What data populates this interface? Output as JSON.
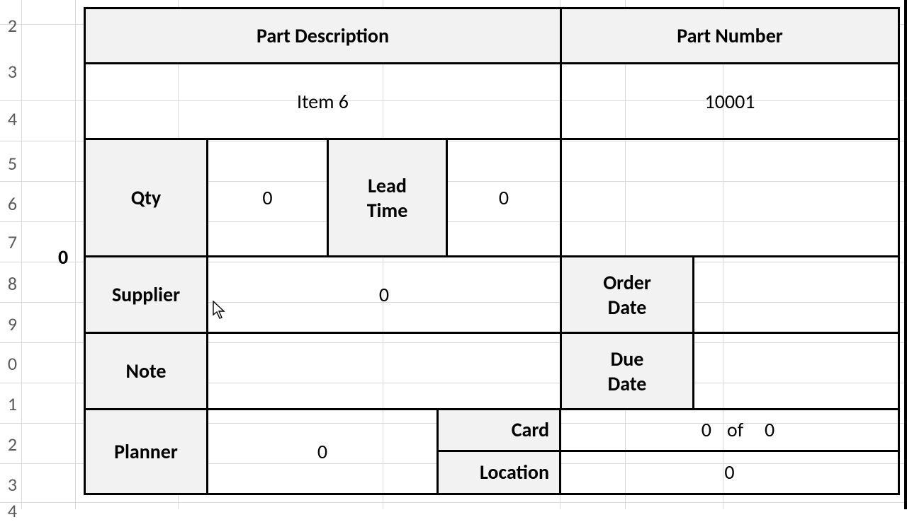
{
  "rows": [
    "2",
    "3",
    "4",
    "5",
    "6",
    "7",
    "8",
    "9",
    "0",
    "1",
    "2",
    "3",
    "4"
  ],
  "side_value": "0",
  "labels": {
    "part_description": "Part Description",
    "part_number": "Part Number",
    "qty": "Qty",
    "lead_time": "Lead\nTime",
    "supplier": "Supplier",
    "order_date": "Order\nDate",
    "note": "Note",
    "due_date": "Due\nDate",
    "planner": "Planner",
    "card": "Card",
    "location": "Location",
    "of": "of"
  },
  "values": {
    "part_description": "Item 6",
    "part_number": "10001",
    "qty": "0",
    "lead_time": "0",
    "supplier": "0",
    "order_date": "",
    "note": "",
    "due_date": "",
    "planner": "0",
    "card_n": "0",
    "card_total": "0",
    "location": "0"
  }
}
